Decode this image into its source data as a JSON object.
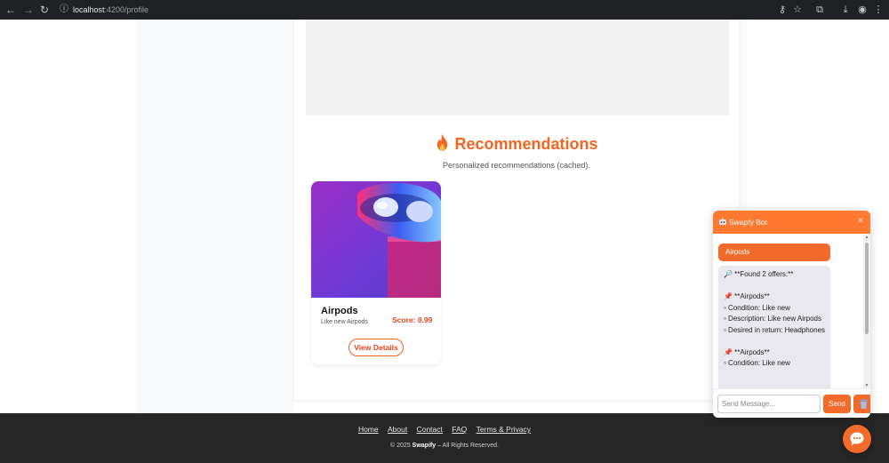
{
  "browser": {
    "url_host": "localhost",
    "url_path": ":4200/profile"
  },
  "recommendations": {
    "title": "Recommendations",
    "subtitle": "Personalized recommendations (cached).",
    "product": {
      "name": "Airpods",
      "description": "Like new Airpods",
      "score": "Score: 0.99",
      "button": "View Details"
    }
  },
  "footer": {
    "links": [
      "Home",
      "About",
      "Contact",
      "FAQ",
      "Terms & Privacy"
    ],
    "copy_prefix": "© 2025",
    "brand": "Swapify",
    "copy_suffix": "– All Rights Reserved."
  },
  "chat": {
    "title": "Swapfy Bot",
    "close": "×",
    "user_message": "Airpods",
    "bot_message": "🔎 **Found 2 offers:**\n\n📌 **Airpods**\n▫ Condition: Like new\n▫ Description: Like new Airpods\n▫ Desired in return: Headphones\n\n📌 **Airpods**\n▫ Condition: Like new",
    "input_placeholder": "Send Message...",
    "send_label": "Send"
  },
  "colors": {
    "accent": "#f26522",
    "chat_accent": "#ff7a30",
    "footer_bg": "#262626"
  }
}
